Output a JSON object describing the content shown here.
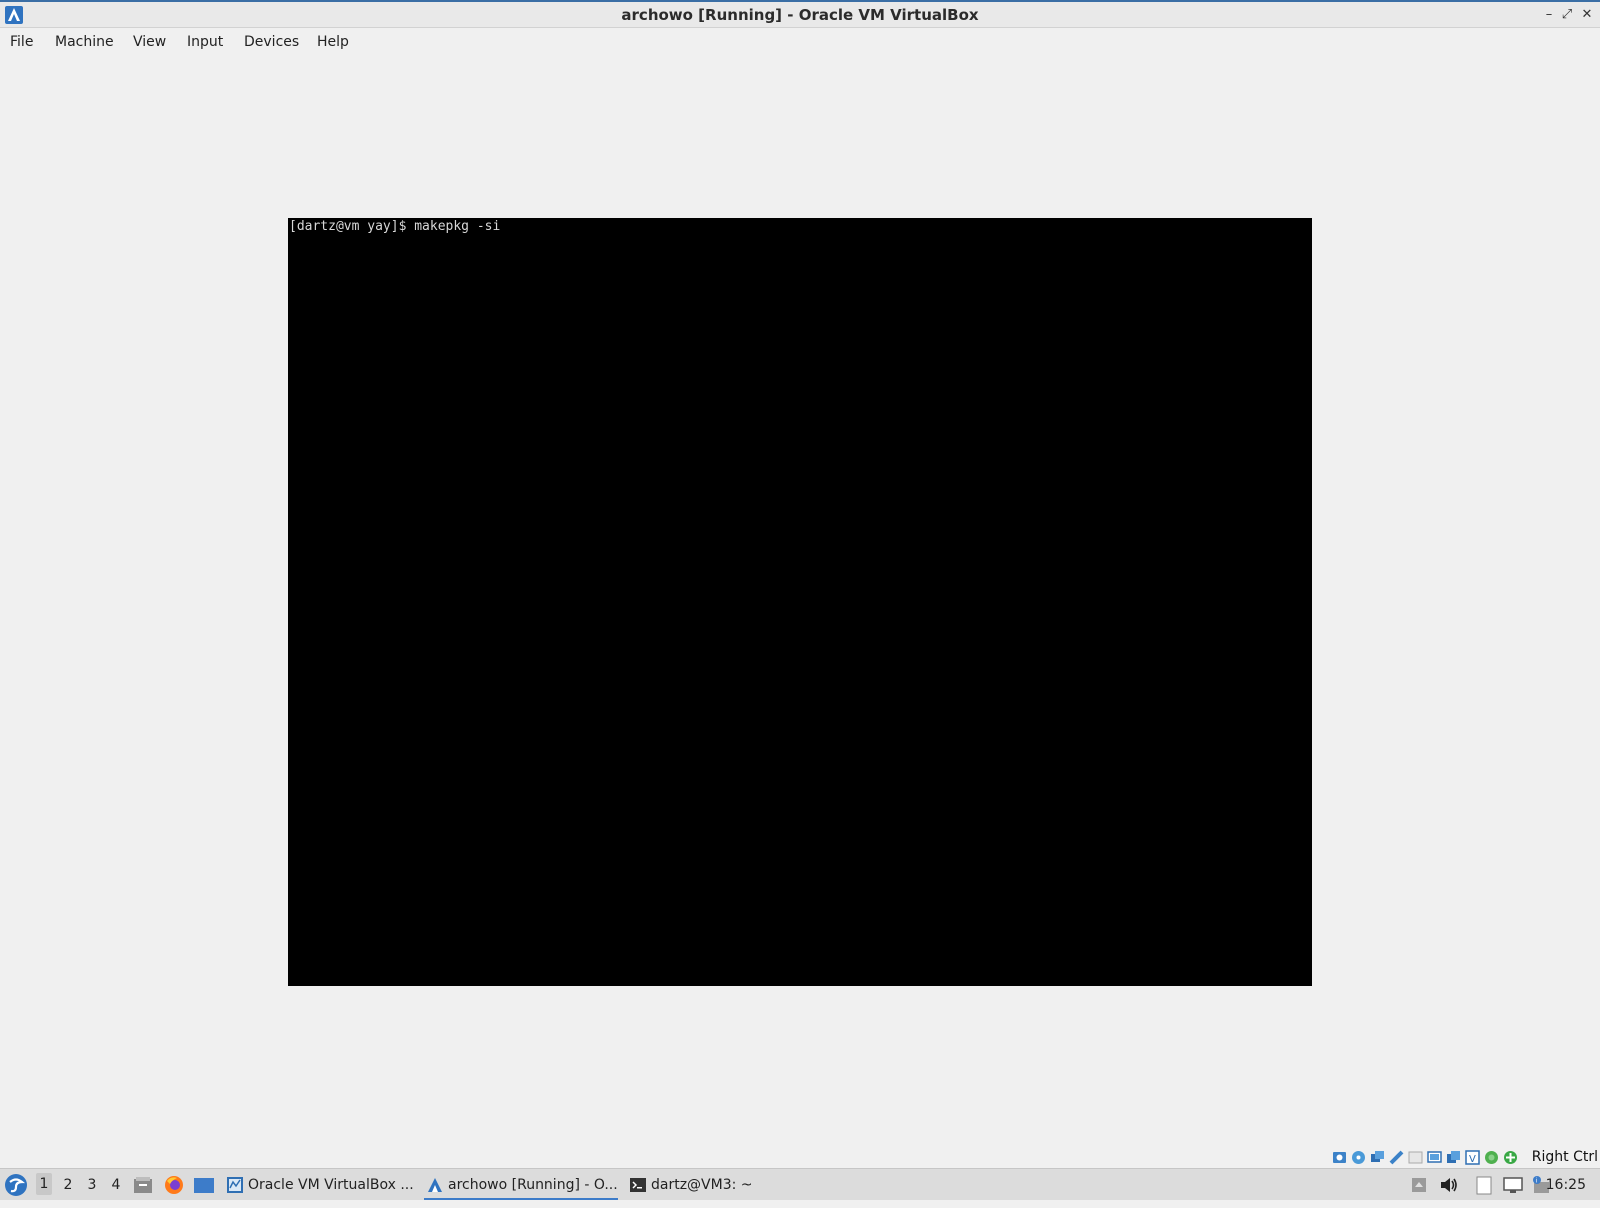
{
  "window": {
    "title": "archowo [Running] - Oracle VM VirtualBox"
  },
  "menu": {
    "items": [
      "File",
      "Machine",
      "View",
      "Input",
      "Devices",
      "Help"
    ]
  },
  "guest": {
    "console_line": "[dartz@vm yay]$ makepkg -si"
  },
  "vbox_status": {
    "icons": [
      "hard-disk-icon",
      "optical-drive-icon",
      "audio-icon",
      "network-icon",
      "usb-icon",
      "shared-folders-icon",
      "display-icon",
      "video-capture-icon",
      "virtualization-icon",
      "mouse-integration-icon",
      "keyboard-icon"
    ],
    "host_key": "Right Ctrl"
  },
  "taskbar": {
    "workspaces": [
      "1",
      "2",
      "3",
      "4"
    ],
    "active_workspace": "1",
    "tasks": [
      {
        "label": "Oracle VM VirtualBox ...",
        "icon": "virtualbox-icon"
      },
      {
        "label": "archowo [Running] - O...",
        "icon": "vm-window-icon"
      },
      {
        "label": "dartz@VM3: ~",
        "icon": "terminal-icon"
      }
    ],
    "clock": "16:25"
  },
  "colors": {
    "accent": "#3d7cc9",
    "guest_background": "#000000",
    "window_background": "#f0f0f0"
  }
}
